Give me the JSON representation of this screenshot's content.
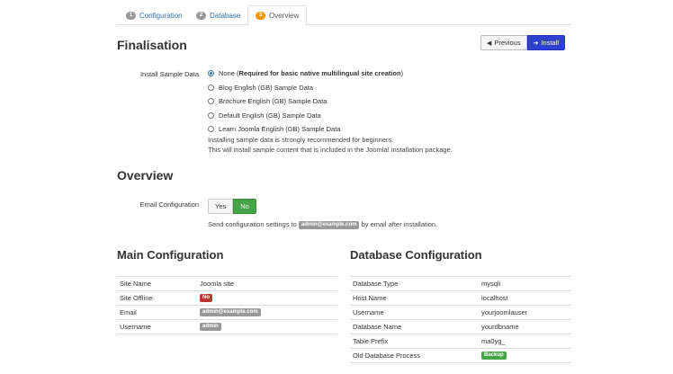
{
  "tabs": [
    {
      "num": "1",
      "label": "Configuration"
    },
    {
      "num": "2",
      "label": "Database"
    },
    {
      "num": "3",
      "label": "Overview"
    }
  ],
  "finalisation": {
    "title": "Finalisation",
    "previous_label": "Previous",
    "install_label": "Install",
    "sample_data_label": "Install Sample Data",
    "options": [
      {
        "label": "None (",
        "bold": "Required for basic native multilingual site creation",
        "suffix": ")",
        "checked": true
      },
      {
        "label": "Blog English (GB) Sample Data",
        "checked": false
      },
      {
        "label": "Brochure English (GB) Sample Data",
        "checked": false
      },
      {
        "label": "Default English (GB) Sample Data",
        "checked": false
      },
      {
        "label": "Learn Joomla English (GB) Sample Data",
        "checked": false
      }
    ],
    "help_line1": "Installing sample data is strongly recommended for beginners.",
    "help_line2": "This will install sample content that is included in the Joomla! installation package."
  },
  "overview": {
    "title": "Overview",
    "email_label": "Email Configuration",
    "yes_label": "Yes",
    "no_label": "No",
    "send_prefix": "Send configuration settings to",
    "send_email": "admin@example.com",
    "send_suffix": "by email after installation."
  },
  "main_config": {
    "title": "Main Configuration",
    "rows": [
      {
        "key": "Site Name",
        "value": "Joomla site"
      },
      {
        "key": "Site Offline",
        "value": "No"
      },
      {
        "key": "Email",
        "value": "admin@example.com"
      },
      {
        "key": "Username",
        "value": "admin"
      }
    ]
  },
  "db_config": {
    "title": "Database Configuration",
    "rows": [
      {
        "key": "Database Type",
        "value": "mysqli"
      },
      {
        "key": "Host Name",
        "value": "localhost"
      },
      {
        "key": "Username",
        "value": "yourjoomlauser"
      },
      {
        "key": "Database Name",
        "value": "yourdbname"
      },
      {
        "key": "Table Prefix",
        "value": "ma0yg_"
      },
      {
        "key": "Old Database Process",
        "value": "Backup"
      }
    ]
  },
  "colors": {
    "active_tab_badge": "#f89406",
    "install_button": "#2f3fcf",
    "no_toggle": "#46a546",
    "danger_badge": "#bd362f"
  }
}
